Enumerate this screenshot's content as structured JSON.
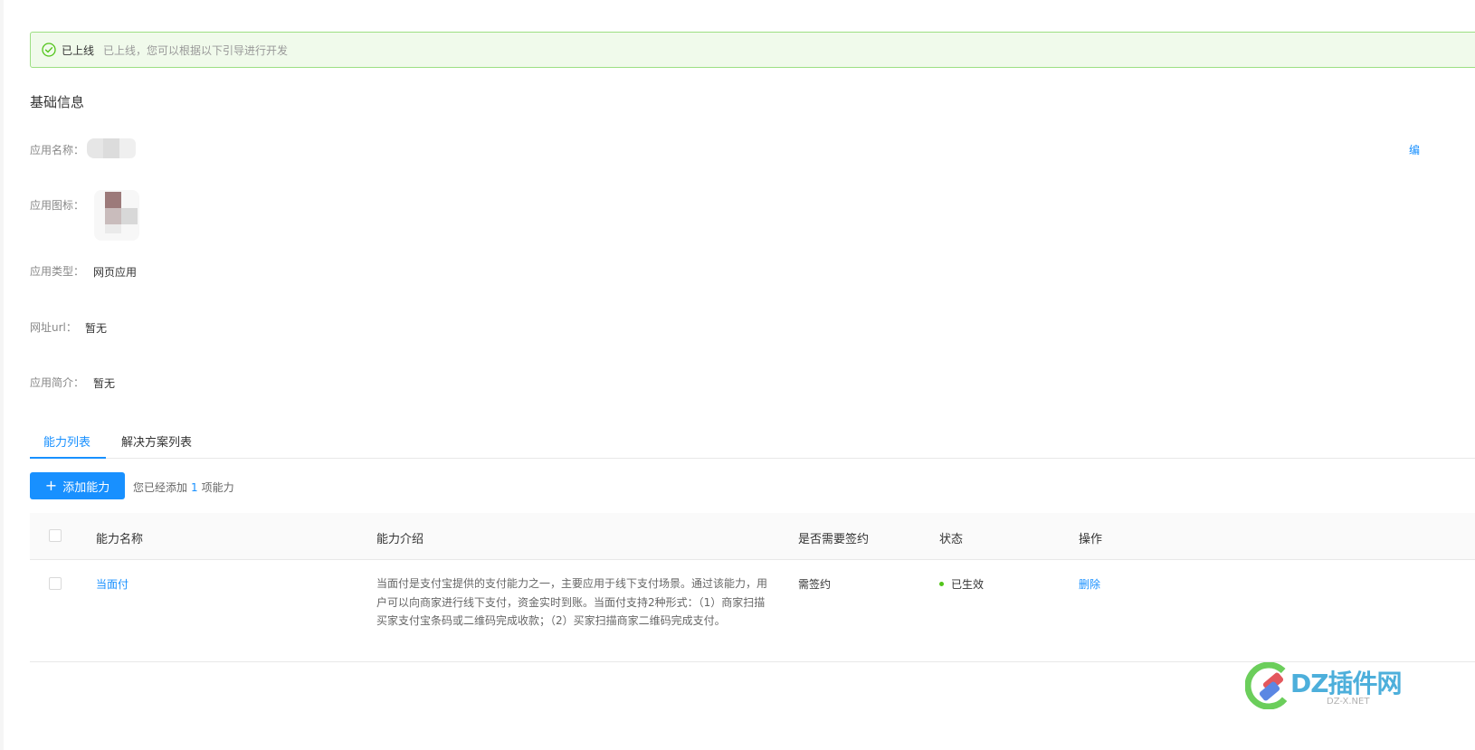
{
  "banner": {
    "title": "已上线",
    "description": "已上线，您可以根据以下引导进行开发"
  },
  "basic_info": {
    "section_title": "基础信息",
    "edit_label": "编",
    "fields": [
      {
        "label": "应用名称：",
        "value": ""
      },
      {
        "label": "应用图标：",
        "value": ""
      },
      {
        "label": "应用类型：",
        "value": "网页应用"
      },
      {
        "label": "网址url：",
        "value": "暂无"
      },
      {
        "label": "应用简介：",
        "value": "暂无"
      }
    ]
  },
  "tabs": [
    {
      "label": "能力列表",
      "active": true
    },
    {
      "label": "解决方案列表",
      "active": false
    }
  ],
  "actions": {
    "add_button_label": "添加能力",
    "hint_prefix": "您已经添加",
    "hint_count": "1",
    "hint_suffix": "项能力"
  },
  "table": {
    "headers": [
      "能力名称",
      "能力介绍",
      "是否需要签约",
      "状态",
      "操作"
    ],
    "rows": [
      {
        "name": "当面付",
        "description": "当面付是支付宝提供的支付能力之一，主要应用于线下支付场景。通过该能力，用户可以向商家进行线下支付，资金实时到账。当面付支持2种形式：（1）商家扫描买家支付宝条码或二维码完成收款；（2）买家扫描商家二维码完成支付。",
        "sign_required": "需签约",
        "status": "已生效",
        "status_color": "#52c41a",
        "operation": "删除"
      }
    ]
  },
  "watermark": {
    "text": "DZ插件网",
    "sub": "DZ-X.NET"
  },
  "colors": {
    "primary": "#1890ff",
    "success": "#52c41a",
    "banner_bg": "#f0faeb",
    "banner_border": "#9cdf83"
  }
}
